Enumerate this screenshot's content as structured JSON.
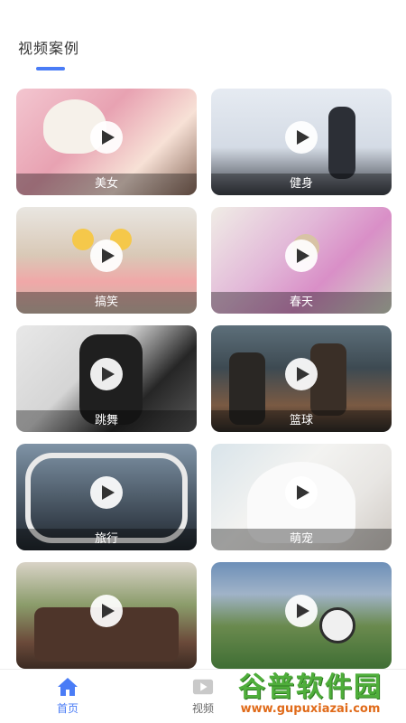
{
  "header": {
    "title": "视频案例"
  },
  "cards": [
    {
      "label": "美女"
    },
    {
      "label": "健身"
    },
    {
      "label": "搞笑"
    },
    {
      "label": "春天"
    },
    {
      "label": "跳舞"
    },
    {
      "label": "篮球"
    },
    {
      "label": "旅行"
    },
    {
      "label": "萌宠"
    },
    {
      "label": ""
    },
    {
      "label": ""
    }
  ],
  "tabbar": {
    "home_label": "首页",
    "video_label": "视频",
    "accent_color": "#4a7cf6"
  },
  "watermark": {
    "title": "谷普软件园",
    "url": "www.gupuxiazai.com"
  }
}
